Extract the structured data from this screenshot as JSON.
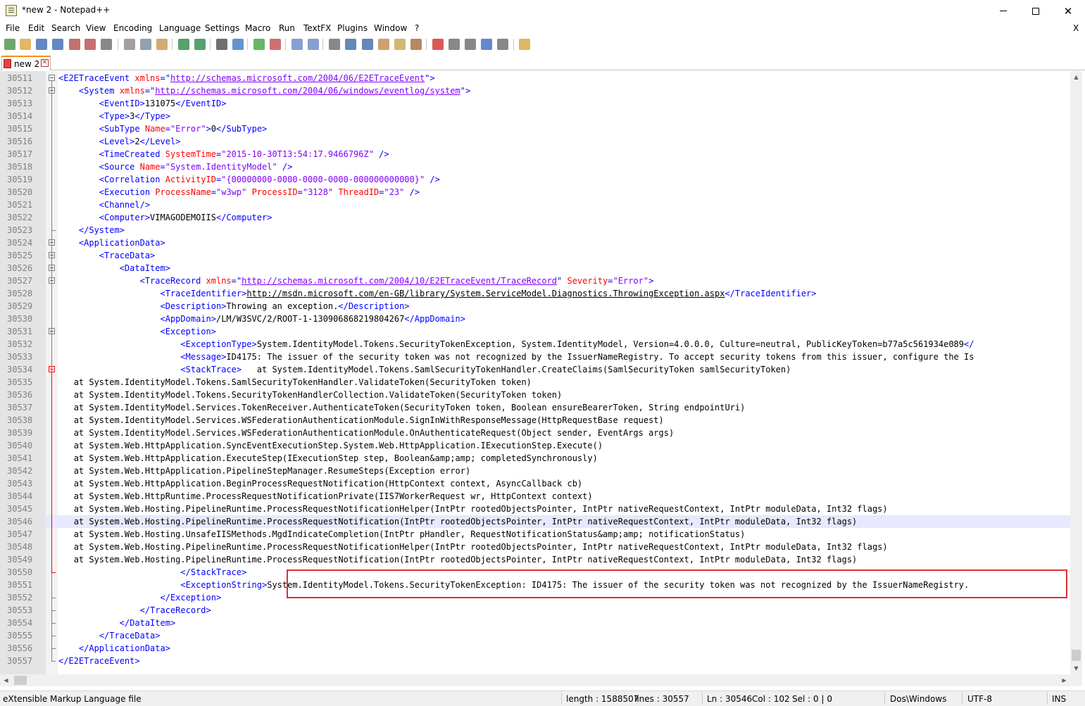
{
  "window": {
    "title": "*new 2 - Notepad++"
  },
  "menu": [
    "File",
    "Edit",
    "Search",
    "View",
    "Encoding",
    "Language",
    "Settings",
    "Macro",
    "Run",
    "TextFX",
    "Plugins",
    "Window",
    "?"
  ],
  "menu_close": "X",
  "toolbar_icons": [
    "new-file-icon",
    "open-file-icon",
    "save-icon",
    "save-all-icon",
    "close-icon",
    "close-all-icon",
    "print-icon",
    "cut-icon",
    "copy-icon",
    "paste-icon",
    "undo-icon",
    "redo-icon",
    "find-icon",
    "replace-icon",
    "zoom-in-icon",
    "zoom-out-icon",
    "sync-vertical-icon",
    "sync-horizontal-icon",
    "word-wrap-icon",
    "show-all-chars-icon",
    "indent-guide-icon",
    "user-language-icon",
    "doc-map-icon",
    "function-list-icon",
    "record-macro-icon",
    "stop-record-icon",
    "play-macro-icon",
    "run-macro-multiple-icon",
    "save-macro-icon",
    "plugin-icon"
  ],
  "tab": {
    "label": "new 2",
    "close": "✕"
  },
  "status": {
    "file_type": "eXtensible Markup Language file",
    "length": "length : 1588507",
    "lines": "lines : 30557",
    "ln": "Ln : 30546",
    "col": "Col : 102",
    "sel": "Sel : 0 | 0",
    "eol": "Dos\\Windows",
    "encoding": "UTF-8",
    "mode": "INS"
  },
  "editor": {
    "current_line": "30546",
    "lines": [
      {
        "n": "30511",
        "i": "",
        "segs": [
          [
            "tg",
            "<E2ETraceEvent "
          ],
          [
            "an",
            "xmlns"
          ],
          [
            "tg",
            "=\""
          ],
          [
            "url",
            "http://schemas.microsoft.com/2004/06/E2ETraceEvent"
          ],
          [
            "tg",
            "\">"
          ]
        ]
      },
      {
        "n": "30512",
        "i": "    ",
        "segs": [
          [
            "tg",
            "<System "
          ],
          [
            "an",
            "xmlns"
          ],
          [
            "tg",
            "=\""
          ],
          [
            "url",
            "http://schemas.microsoft.com/2004/06/windows/eventlog/system"
          ],
          [
            "tg",
            "\">"
          ]
        ]
      },
      {
        "n": "30513",
        "i": "        ",
        "segs": [
          [
            "tg",
            "<EventID>"
          ],
          [
            "tx",
            "131075"
          ],
          [
            "tg",
            "</EventID>"
          ]
        ]
      },
      {
        "n": "30514",
        "i": "        ",
        "segs": [
          [
            "tg",
            "<Type>"
          ],
          [
            "tx",
            "3"
          ],
          [
            "tg",
            "</Type>"
          ]
        ]
      },
      {
        "n": "30515",
        "i": "        ",
        "segs": [
          [
            "tg",
            "<SubType "
          ],
          [
            "an",
            "Name"
          ],
          [
            "tg",
            "="
          ],
          [
            "av",
            "\"Error\""
          ],
          [
            "tg",
            ">"
          ],
          [
            "tx",
            "0"
          ],
          [
            "tg",
            "</SubType>"
          ]
        ]
      },
      {
        "n": "30516",
        "i": "        ",
        "segs": [
          [
            "tg",
            "<Level>"
          ],
          [
            "tx",
            "2"
          ],
          [
            "tg",
            "</Level>"
          ]
        ]
      },
      {
        "n": "30517",
        "i": "        ",
        "segs": [
          [
            "tg",
            "<TimeCreated "
          ],
          [
            "an",
            "SystemTime"
          ],
          [
            "tg",
            "="
          ],
          [
            "av",
            "\"2015-10-30T13:54:17.9466796Z\""
          ],
          [
            "tg",
            " />"
          ]
        ]
      },
      {
        "n": "30518",
        "i": "        ",
        "segs": [
          [
            "tg",
            "<Source "
          ],
          [
            "an",
            "Name"
          ],
          [
            "tg",
            "="
          ],
          [
            "av",
            "\"System.IdentityModel\""
          ],
          [
            "tg",
            " />"
          ]
        ]
      },
      {
        "n": "30519",
        "i": "        ",
        "segs": [
          [
            "tg",
            "<Correlation "
          ],
          [
            "an",
            "ActivityID"
          ],
          [
            "tg",
            "="
          ],
          [
            "av",
            "\"{00000000-0000-0000-0000-000000000000}\""
          ],
          [
            "tg",
            " />"
          ]
        ]
      },
      {
        "n": "30520",
        "i": "        ",
        "segs": [
          [
            "tg",
            "<Execution "
          ],
          [
            "an",
            "ProcessName"
          ],
          [
            "tg",
            "="
          ],
          [
            "av",
            "\"w3wp\""
          ],
          [
            "tg",
            " "
          ],
          [
            "an",
            "ProcessID"
          ],
          [
            "tg",
            "="
          ],
          [
            "av",
            "\"3128\""
          ],
          [
            "tg",
            " "
          ],
          [
            "an",
            "ThreadID"
          ],
          [
            "tg",
            "="
          ],
          [
            "av",
            "\"23\""
          ],
          [
            "tg",
            " />"
          ]
        ]
      },
      {
        "n": "30521",
        "i": "        ",
        "segs": [
          [
            "tg",
            "<Channel/>"
          ]
        ]
      },
      {
        "n": "30522",
        "i": "        ",
        "segs": [
          [
            "tg",
            "<Computer>"
          ],
          [
            "tx",
            "VIMAGODEMOIIS"
          ],
          [
            "tg",
            "</Computer>"
          ]
        ]
      },
      {
        "n": "30523",
        "i": "    ",
        "segs": [
          [
            "tg",
            "</System>"
          ]
        ]
      },
      {
        "n": "30524",
        "i": "    ",
        "segs": [
          [
            "tg",
            "<ApplicationData>"
          ]
        ]
      },
      {
        "n": "30525",
        "i": "        ",
        "segs": [
          [
            "tg",
            "<TraceData>"
          ]
        ]
      },
      {
        "n": "30526",
        "i": "            ",
        "segs": [
          [
            "tg",
            "<DataItem>"
          ]
        ]
      },
      {
        "n": "30527",
        "i": "                ",
        "segs": [
          [
            "tg",
            "<TraceRecord "
          ],
          [
            "an",
            "xmlns"
          ],
          [
            "tg",
            "=\""
          ],
          [
            "url",
            "http://schemas.microsoft.com/2004/10/E2ETraceEvent/TraceRecord"
          ],
          [
            "tg",
            "\" "
          ],
          [
            "an",
            "Severity"
          ],
          [
            "tg",
            "="
          ],
          [
            "av",
            "\"Error\""
          ],
          [
            "tg",
            ">"
          ]
        ]
      },
      {
        "n": "30528",
        "i": "                    ",
        "segs": [
          [
            "tg",
            "<TraceIdentifier>"
          ],
          [
            "ul",
            "http://msdn.microsoft.com/en-GB/library/System.ServiceModel.Diagnostics.ThrowingException.aspx"
          ],
          [
            "tg",
            "</TraceIdentifier>"
          ]
        ]
      },
      {
        "n": "30529",
        "i": "                    ",
        "segs": [
          [
            "tg",
            "<Description>"
          ],
          [
            "tx",
            "Throwing an exception."
          ],
          [
            "tg",
            "</Description>"
          ]
        ]
      },
      {
        "n": "30530",
        "i": "                    ",
        "segs": [
          [
            "tg",
            "<AppDomain>"
          ],
          [
            "tx",
            "/LM/W3SVC/2/ROOT-1-130906868219804267"
          ],
          [
            "tg",
            "</AppDomain>"
          ]
        ]
      },
      {
        "n": "30531",
        "i": "                    ",
        "segs": [
          [
            "tg",
            "<Exception>"
          ]
        ]
      },
      {
        "n": "30532",
        "i": "                        ",
        "segs": [
          [
            "tg",
            "<ExceptionType>"
          ],
          [
            "tx",
            "System.IdentityModel.Tokens.SecurityTokenException, System.IdentityModel, Version=4.0.0.0, Culture=neutral, PublicKeyToken=b77a5c561934e089"
          ],
          [
            "tg",
            "</"
          ]
        ]
      },
      {
        "n": "30533",
        "i": "                        ",
        "segs": [
          [
            "tg",
            "<Message>"
          ],
          [
            "tx",
            "ID4175: The issuer of the security token was not recognized by the IssuerNameRegistry. To accept security tokens from this issuer, configure the Is"
          ]
        ]
      },
      {
        "n": "30534",
        "i": "                        ",
        "segs": [
          [
            "tg",
            "<StackTrace>"
          ],
          [
            "tx",
            "   at System.IdentityModel.Tokens.SamlSecurityTokenHandler.CreateClaims(SamlSecurityToken samlSecurityToken)"
          ]
        ]
      },
      {
        "n": "30535",
        "i": "   ",
        "segs": [
          [
            "tx",
            "at System.IdentityModel.Tokens.SamlSecurityTokenHandler.ValidateToken(SecurityToken token)"
          ]
        ]
      },
      {
        "n": "30536",
        "i": "   ",
        "segs": [
          [
            "tx",
            "at System.IdentityModel.Tokens.SecurityTokenHandlerCollection.ValidateToken(SecurityToken token)"
          ]
        ]
      },
      {
        "n": "30537",
        "i": "   ",
        "segs": [
          [
            "tx",
            "at System.IdentityModel.Services.TokenReceiver.AuthenticateToken(SecurityToken token, Boolean ensureBearerToken, String endpointUri)"
          ]
        ]
      },
      {
        "n": "30538",
        "i": "   ",
        "segs": [
          [
            "tx",
            "at System.IdentityModel.Services.WSFederationAuthenticationModule.SignInWithResponseMessage(HttpRequestBase request)"
          ]
        ]
      },
      {
        "n": "30539",
        "i": "   ",
        "segs": [
          [
            "tx",
            "at System.IdentityModel.Services.WSFederationAuthenticationModule.OnAuthenticateRequest(Object sender, EventArgs args)"
          ]
        ]
      },
      {
        "n": "30540",
        "i": "   ",
        "segs": [
          [
            "tx",
            "at System.Web.HttpApplication.SyncEventExecutionStep.System.Web.HttpApplication.IExecutionStep.Execute()"
          ]
        ]
      },
      {
        "n": "30541",
        "i": "   ",
        "segs": [
          [
            "tx",
            "at System.Web.HttpApplication.ExecuteStep(IExecutionStep step, Boolean&amp;amp; completedSynchronously)"
          ]
        ]
      },
      {
        "n": "30542",
        "i": "   ",
        "segs": [
          [
            "tx",
            "at System.Web.HttpApplication.PipelineStepManager.ResumeSteps(Exception error)"
          ]
        ]
      },
      {
        "n": "30543",
        "i": "   ",
        "segs": [
          [
            "tx",
            "at System.Web.HttpApplication.BeginProcessRequestNotification(HttpContext context, AsyncCallback cb)"
          ]
        ]
      },
      {
        "n": "30544",
        "i": "   ",
        "segs": [
          [
            "tx",
            "at System.Web.HttpRuntime.ProcessRequestNotificationPrivate(IIS7WorkerRequest wr, HttpContext context)"
          ]
        ]
      },
      {
        "n": "30545",
        "i": "   ",
        "segs": [
          [
            "tx",
            "at System.Web.Hosting.PipelineRuntime.ProcessRequestNotificationHelper(IntPtr rootedObjectsPointer, IntPtr nativeRequestContext, IntPtr moduleData, Int32 flags)"
          ]
        ]
      },
      {
        "n": "30546",
        "i": "   ",
        "segs": [
          [
            "tx",
            "at System.Web.Hosting.PipelineRuntime.ProcessRequestNotification(IntPtr rootedObjectsPointer, IntPtr nativeRequestContext, IntPtr moduleData, Int32 flags)"
          ]
        ]
      },
      {
        "n": "30547",
        "i": "   ",
        "segs": [
          [
            "tx",
            "at System.Web.Hosting.UnsafeIISMethods.MgdIndicateCompletion(IntPtr pHandler, RequestNotificationStatus&amp;amp; notificationStatus)"
          ]
        ]
      },
      {
        "n": "30548",
        "i": "   ",
        "segs": [
          [
            "tx",
            "at System.Web.Hosting.PipelineRuntime.ProcessRequestNotificationHelper(IntPtr rootedObjectsPointer, IntPtr nativeRequestContext, IntPtr moduleData, Int32 flags)"
          ]
        ]
      },
      {
        "n": "30549",
        "i": "   ",
        "segs": [
          [
            "tx",
            "at System.Web.Hosting.PipelineRuntime.ProcessRequestNotification(IntPtr rootedObjectsPointer, IntPtr nativeRequestContext, IntPtr moduleData, Int32 flags)"
          ]
        ]
      },
      {
        "n": "30550",
        "i": "                        ",
        "segs": [
          [
            "tg",
            "</StackTrace>"
          ]
        ]
      },
      {
        "n": "30551",
        "i": "                        ",
        "segs": [
          [
            "tg",
            "<ExceptionString>"
          ],
          [
            "tx",
            "System.IdentityModel.Tokens.SecurityTokenException: ID4175: The issuer of the security token was not recognized by the IssuerNameRegistry."
          ]
        ]
      },
      {
        "n": "30552",
        "i": "                    ",
        "segs": [
          [
            "tg",
            "</Exception>"
          ]
        ]
      },
      {
        "n": "30553",
        "i": "                ",
        "segs": [
          [
            "tg",
            "</TraceRecord>"
          ]
        ]
      },
      {
        "n": "30554",
        "i": "            ",
        "segs": [
          [
            "tg",
            "</DataItem>"
          ]
        ]
      },
      {
        "n": "30555",
        "i": "        ",
        "segs": [
          [
            "tg",
            "</TraceData>"
          ]
        ]
      },
      {
        "n": "30556",
        "i": "    ",
        "segs": [
          [
            "tg",
            "</ApplicationData>"
          ]
        ]
      },
      {
        "n": "30557",
        "i": "",
        "segs": [
          [
            "tg",
            "</E2ETraceEvent>"
          ]
        ]
      }
    ]
  }
}
